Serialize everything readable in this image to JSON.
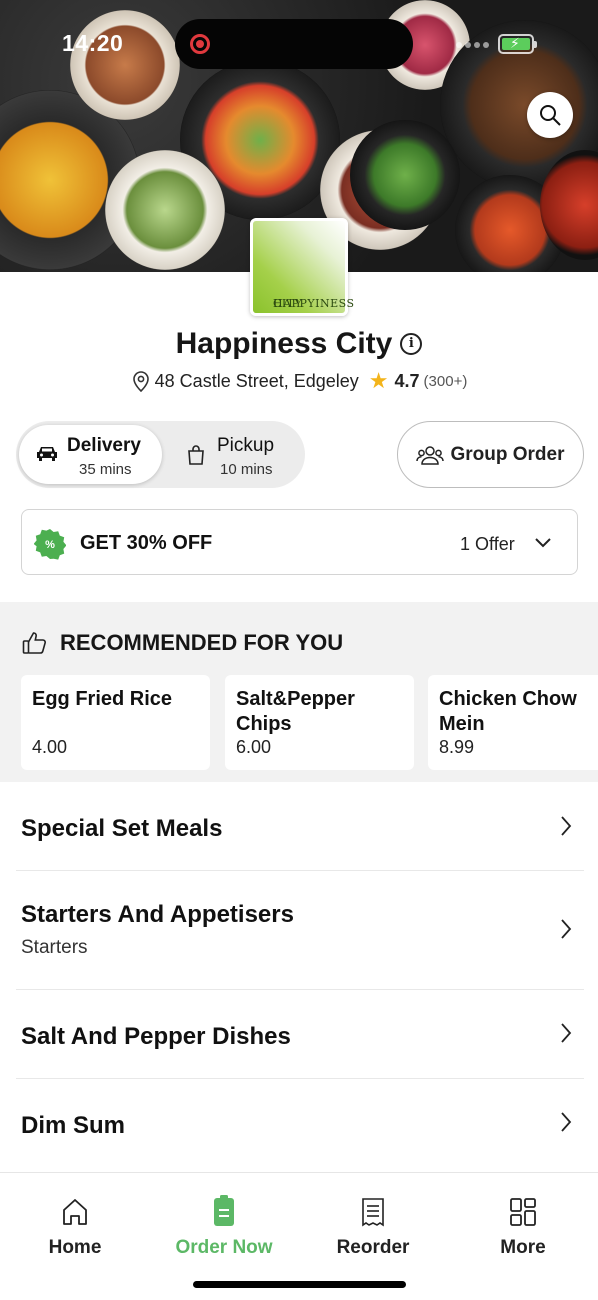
{
  "status_bar": {
    "time": "14:20"
  },
  "restaurant": {
    "logo_text_line1": "HAPPYINESS",
    "logo_text_line2": "CITY",
    "name": "Happiness City",
    "address": "48 Castle Street, Edgeley",
    "rating": "4.7",
    "reviews": "(300+)"
  },
  "fulfilment": {
    "delivery_label": "Delivery",
    "delivery_time": "35 mins",
    "pickup_label": "Pickup",
    "pickup_time": "10 mins",
    "selected": "delivery"
  },
  "group_order_label": "Group Order",
  "offer": {
    "text": "GET 30% OFF",
    "count": "1 Offer"
  },
  "recommended": {
    "title": "RECOMMENDED FOR YOU",
    "items": [
      {
        "name": "Egg Fried Rice",
        "price": "4.00"
      },
      {
        "name": "Salt&Pepper Chips",
        "price": "6.00"
      },
      {
        "name": "Chicken Chow Mein",
        "price": "8.99"
      }
    ]
  },
  "categories": [
    {
      "title": "Special Set Meals",
      "subtitle": ""
    },
    {
      "title": "Starters And Appetisers",
      "subtitle": "Starters"
    },
    {
      "title": "Salt And Pepper Dishes",
      "subtitle": ""
    },
    {
      "title": "Dim Sum",
      "subtitle": ""
    }
  ],
  "tabs": [
    {
      "label": "Home",
      "icon": "home-icon"
    },
    {
      "label": "Order Now",
      "icon": "order-icon"
    },
    {
      "label": "Reorder",
      "icon": "receipt-icon"
    },
    {
      "label": "More",
      "icon": "grid-icon"
    }
  ],
  "colors": {
    "accent_green": "#5cb866",
    "star": "#f3b41b",
    "offer_badge": "#4caf50"
  }
}
